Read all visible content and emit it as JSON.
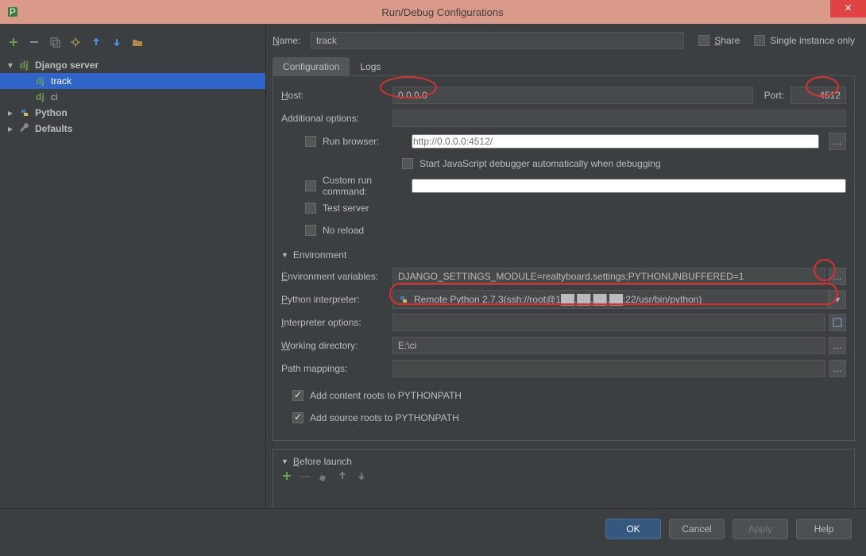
{
  "window": {
    "title": "Run/Debug Configurations"
  },
  "toolbar_icons": [
    "add",
    "remove",
    "copy",
    "settings",
    "up",
    "down",
    "folder"
  ],
  "tree": {
    "items": [
      {
        "label": "Django server",
        "icon": "dj",
        "expanded": true,
        "children": [
          {
            "label": "track",
            "icon": "dj",
            "selected": true
          },
          {
            "label": "ci",
            "icon": "dj"
          }
        ]
      },
      {
        "label": "Python",
        "icon": "python"
      },
      {
        "label": "Defaults",
        "icon": "wrench"
      }
    ]
  },
  "name_row": {
    "label": "Name:",
    "value": "track",
    "share": "Share",
    "single": "Single instance only"
  },
  "tabs": [
    {
      "label": "Configuration",
      "active": true
    },
    {
      "label": "Logs"
    }
  ],
  "config": {
    "host_label": "Host:",
    "host": "0.0.0.0",
    "port_label": "Port:",
    "port": "4512",
    "additional_label": "Additional options:",
    "additional": "",
    "run_browser_label": "Run browser:",
    "run_browser_placeholder": "http://0.0.0.0:4512/",
    "js_debug": "Start JavaScript debugger automatically when debugging",
    "custom_run_label": "Custom run command:",
    "custom_run": "",
    "test_server": "Test server",
    "no_reload": "No reload",
    "env_head": "Environment",
    "env_vars_label": "Environment variables:",
    "env_vars": "DJANGO_SETTINGS_MODULE=realtyboard.settings;PYTHONUNBUFFERED=1",
    "interp_label": "Python interpreter:",
    "interp": "Remote Python 2.7.3(ssh://root@1██.██.██.██:22/usr/bin/python)",
    "interp_opts_label": "Interpreter options:",
    "interp_opts": "",
    "wd_label": "Working directory:",
    "wd": "E:\\ci",
    "path_map_label": "Path mappings:",
    "path_map": "",
    "add_content": "Add content roots to PYTHONPATH",
    "add_source": "Add source roots to PYTHONPATH"
  },
  "before_launch": {
    "head": "Before launch"
  },
  "buttons": {
    "ok": "OK",
    "cancel": "Cancel",
    "apply": "Apply",
    "help": "Help"
  }
}
